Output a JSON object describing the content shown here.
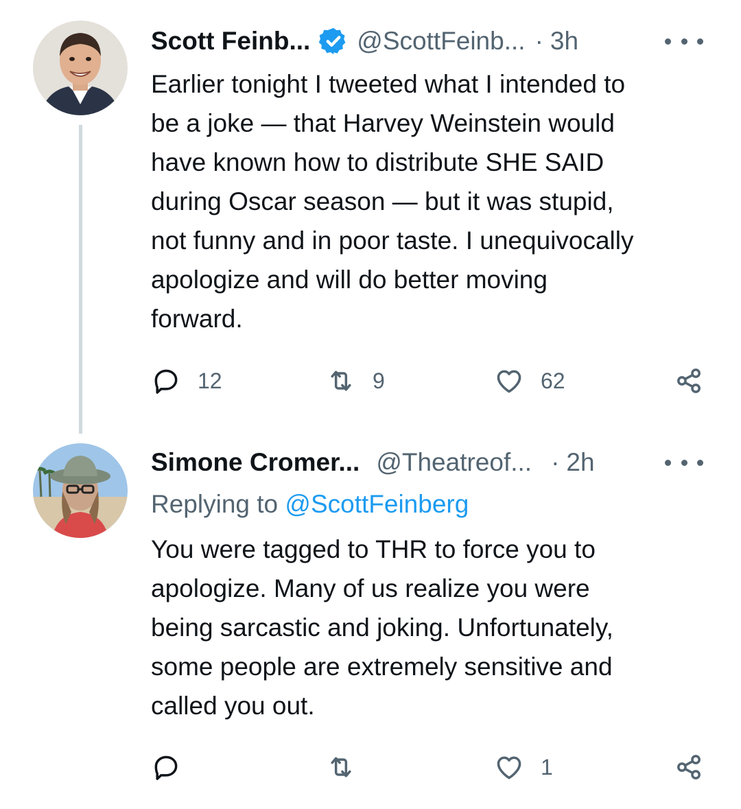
{
  "tweets": [
    {
      "display_name": "Scott Feinb...",
      "handle": "@ScottFeinb...",
      "separator": "·",
      "time": "3h",
      "verified": true,
      "text": "Earlier tonight I tweeted what I intended to\nbe a joke — that Harvey Weinstein would\nhave known how to distribute SHE SAID\nduring Oscar season — but it was stupid,\nnot funny and in poor taste. I unequivocally\napologize and will do better moving\nforward.",
      "actions": {
        "reply_count": "12",
        "retweet_count": "9",
        "like_count": "62"
      }
    },
    {
      "display_name": "Simone Cromer...",
      "handle": "@Theatreof...",
      "separator": "·",
      "time": "2h",
      "verified": false,
      "replying_label": "Replying to",
      "replying_to": "@ScottFeinberg",
      "text": "You were tagged to THR to force you to\napologize. Many of us realize you were\nbeing sarcastic and joking. Unfortunately,\nsome people are extremely sensitive and\ncalled you out.",
      "actions": {
        "reply_count": "",
        "retweet_count": "",
        "like_count": "1"
      }
    }
  ],
  "icons": {
    "verified": "verified-badge-icon",
    "more": "more-options-icon",
    "reply": "reply-bubble-icon",
    "retweet": "retweet-icon",
    "like": "heart-icon",
    "share": "share-icon"
  },
  "colors": {
    "text": "#0f1419",
    "secondary": "#536471",
    "link": "#1d9bf0",
    "thread_line": "#cfd9de"
  }
}
